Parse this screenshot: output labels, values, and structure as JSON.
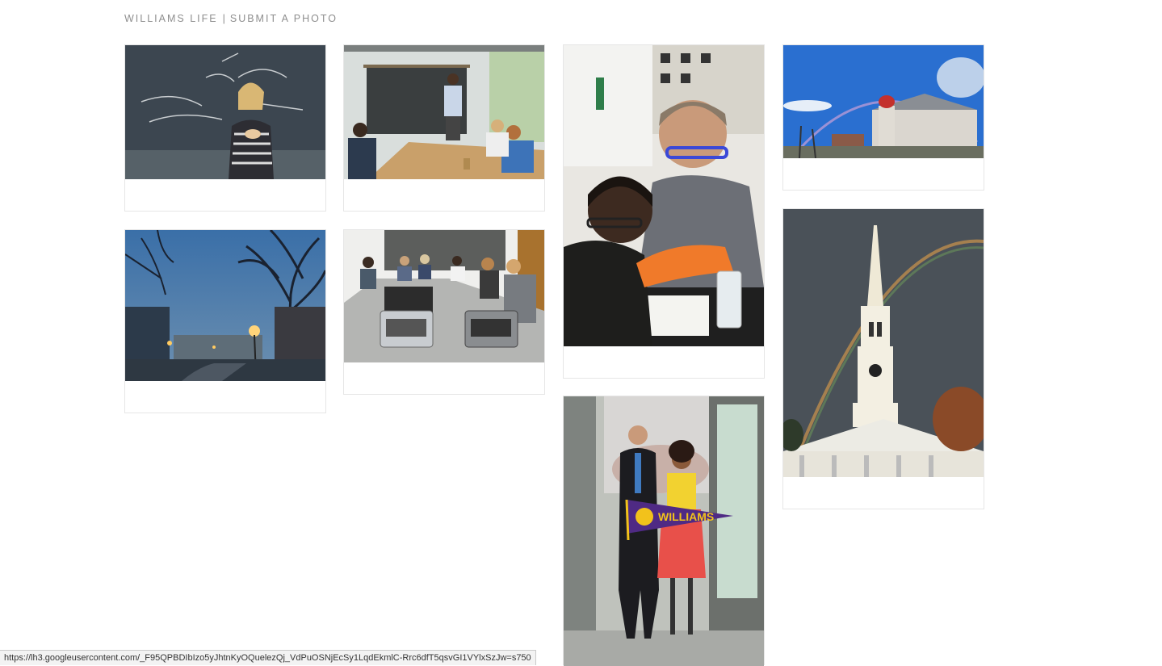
{
  "nav": {
    "site_link": "WILLIAMS LIFE",
    "separator": "|",
    "submit_link": "SUBMIT A PHOTO"
  },
  "gallery": [
    {
      "subject": "Professor teaching at a chalkboard",
      "icon": "photo-icon"
    },
    {
      "subject": "Seminar room with instructor at blackboard",
      "icon": "photo-icon"
    },
    {
      "subject": "Student and instructor in chemistry lab",
      "icon": "photo-icon"
    },
    {
      "subject": "Campus building with rainbow and blue sky",
      "icon": "photo-icon"
    },
    {
      "subject": "Foggy campus evening with lampposts",
      "icon": "photo-icon"
    },
    {
      "subject": "Class with typewriters around a table",
      "icon": "photo-icon"
    },
    {
      "subject": "Chapel steeple with rainbow",
      "icon": "photo-icon"
    },
    {
      "subject": "Two people holding a WILLIAMS pennant",
      "icon": "photo-icon",
      "pennant_text": "WILLIAMS"
    }
  ],
  "status_bar": {
    "url": "https://lh3.googleusercontent.com/_F95QPBDIbIzo5yJhtnKyOQuelezQj_VdPuOSNjEcSy1LqdEkmlC-Rrc6dfT5qsvGI1VYlxSzJw=s750"
  },
  "colors": {
    "nav_text": "#8e8e8e",
    "card_border": "#e6e6e6",
    "purple": "#4f2a84",
    "gold": "#f2c21b"
  }
}
